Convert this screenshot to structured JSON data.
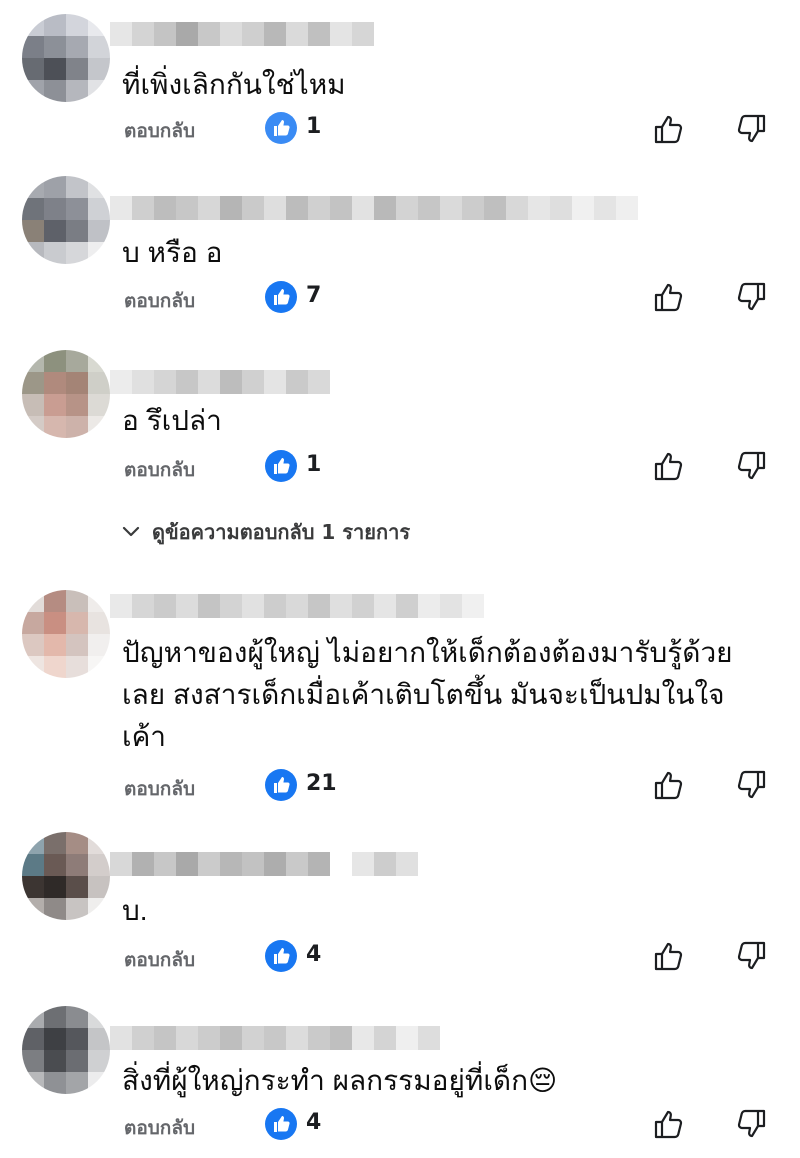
{
  "comments": [
    {
      "text": "ที่เพิ่งเลิกกันใช่ไหม",
      "reply_label": "ตอบกลับ",
      "likes": "1"
    },
    {
      "text": "บ หรือ อ",
      "reply_label": "ตอบกลับ",
      "likes": "7"
    },
    {
      "text": "อ รึเปล่า",
      "reply_label": "ตอบกลับ",
      "likes": "1"
    },
    {
      "text": "ปัญหาของผู้ใหญ่ ไม่อยากให้เด็กต้องต้องมารับรู้ด้วยเลย สงสารเด็กเมื่อเค้าเติบโตขึ้น มันจะเป็นปมในใจเค้า",
      "reply_label": "ตอบกลับ",
      "likes": "21"
    },
    {
      "text": "บ.",
      "reply_label": "ตอบกลับ",
      "likes": "4"
    },
    {
      "text": "สิ่งที่ผู้ใหญ่กระทำ ผลกรรมอยู่ที่เด็ก",
      "emoji": "😔",
      "reply_label": "ตอบกลับ",
      "likes": "4"
    }
  ],
  "view_replies": {
    "label": "ดูข้อความตอบกลับ 1 รายการ",
    "icon": "chevron-down-icon"
  },
  "colors": {
    "like_blue": "#1877f2",
    "muted": "#65676b"
  }
}
